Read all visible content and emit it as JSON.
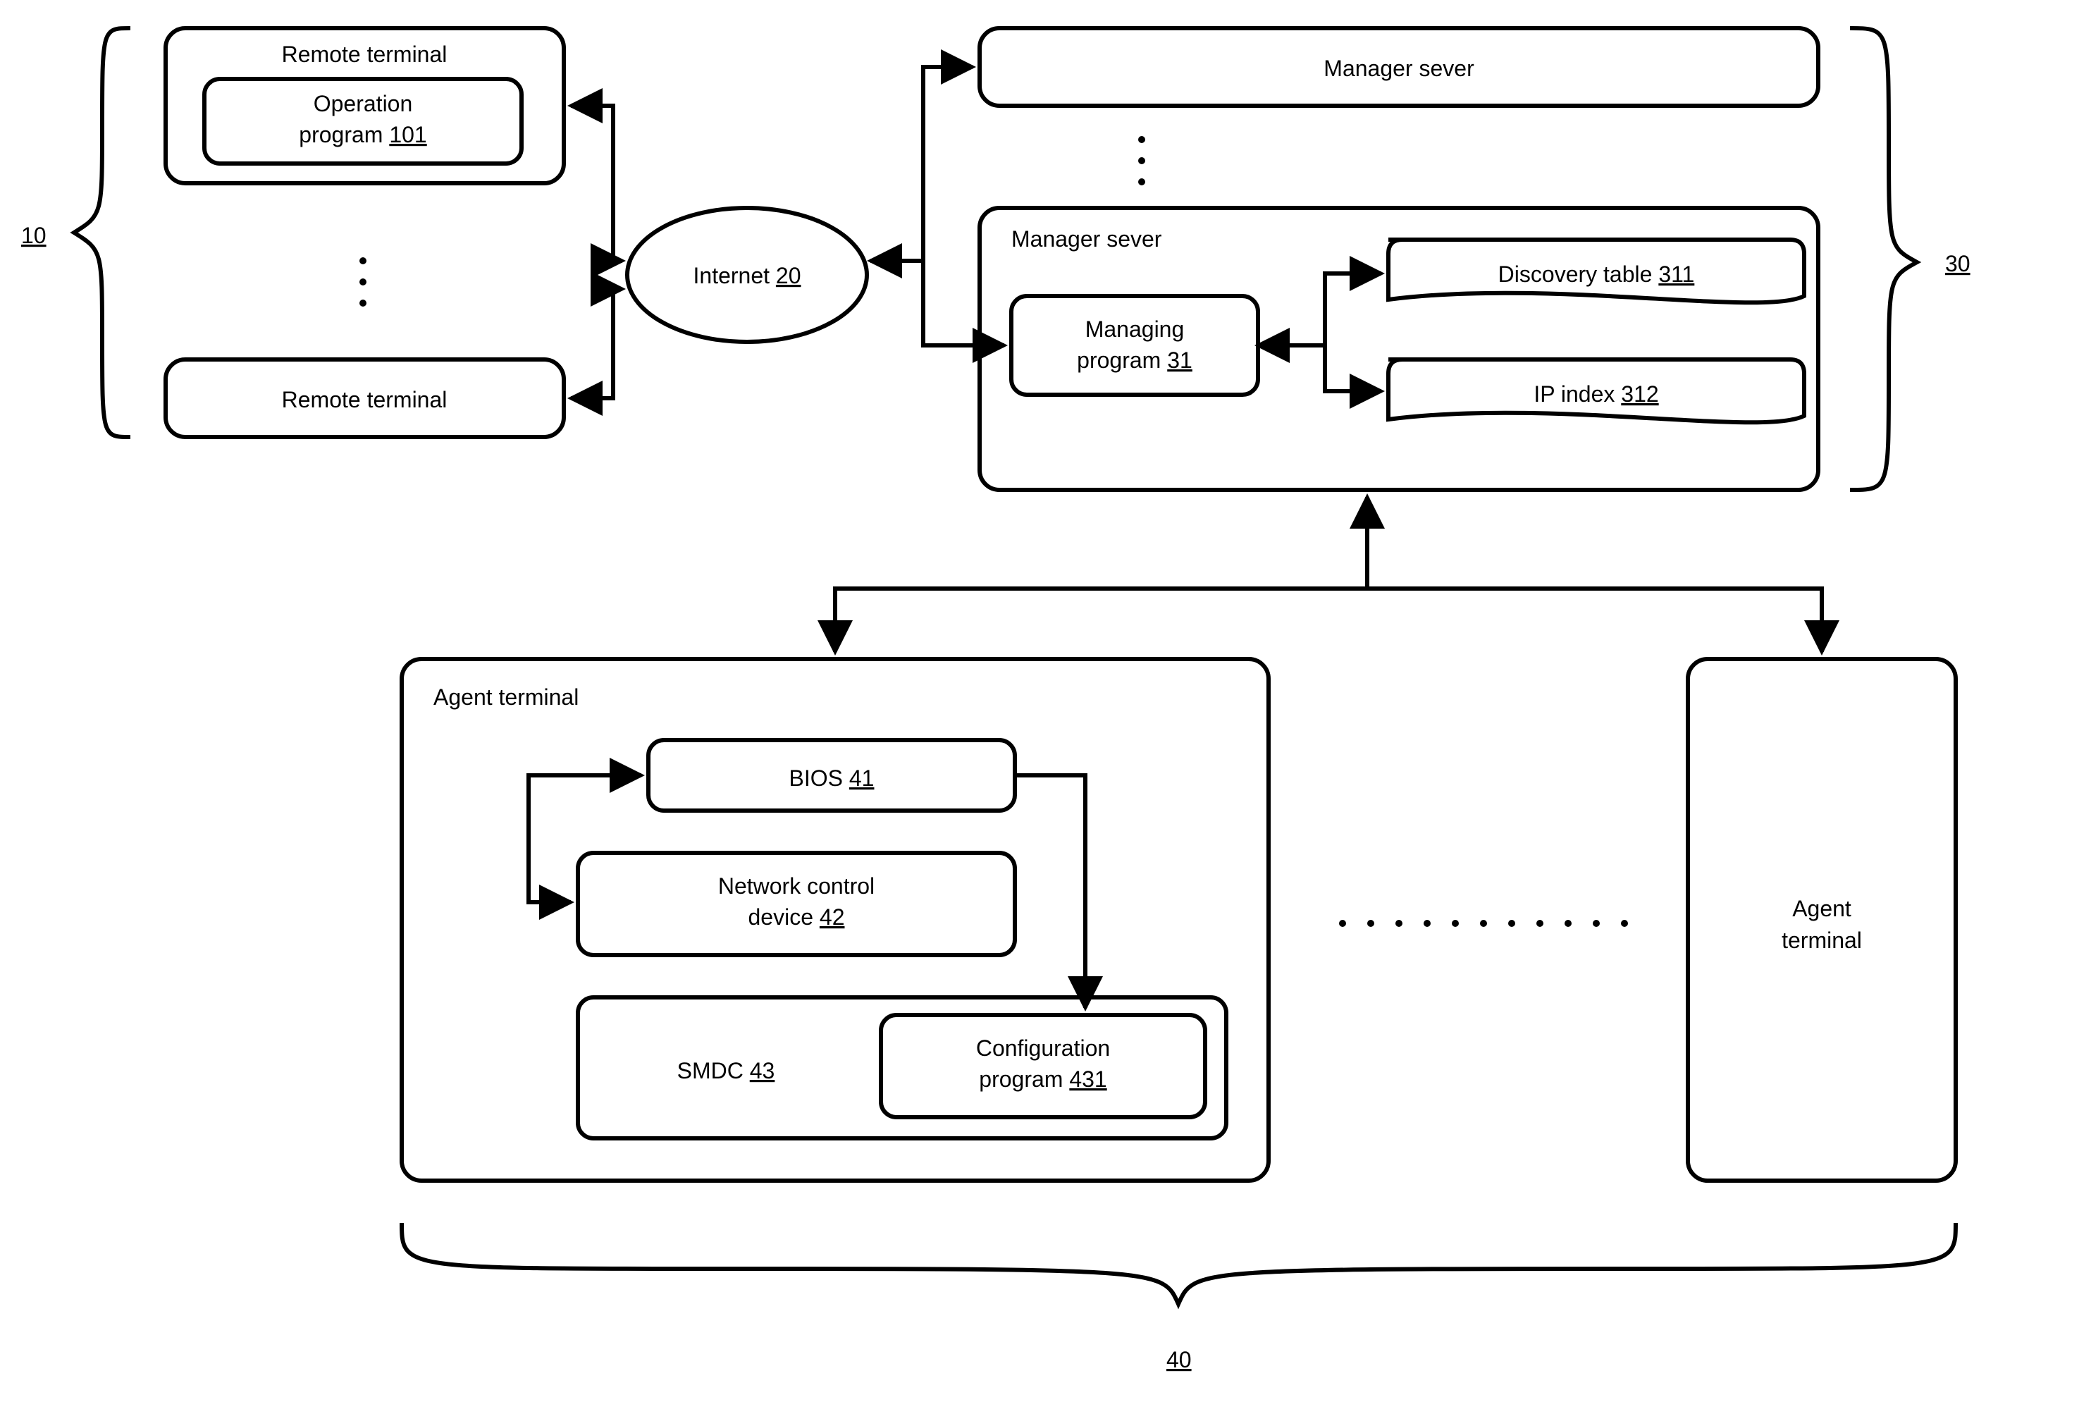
{
  "group10": {
    "label": "10"
  },
  "group30": {
    "label": "30"
  },
  "group40": {
    "label": "40"
  },
  "remoteTerminal1": {
    "title": "Remote terminal"
  },
  "opProgram": {
    "line1": "Operation",
    "line2_prefix": "program ",
    "line2_num": "101"
  },
  "remoteTerminal2": {
    "title": "Remote terminal"
  },
  "internet": {
    "label_prefix": "Internet ",
    "label_num": "20"
  },
  "managerServer1": {
    "title": "Manager sever"
  },
  "managerServer2": {
    "title": "Manager sever"
  },
  "managingProgram": {
    "line1": "Managing",
    "line2_prefix": "program ",
    "line2_num": "31"
  },
  "discoveryTable": {
    "label_prefix": "Discovery table ",
    "label_num": "311"
  },
  "ipIndex": {
    "label_prefix": "IP index ",
    "label_num": "312"
  },
  "agentTerminal1": {
    "title": "Agent terminal"
  },
  "agentTerminal2": {
    "line1": "Agent",
    "line2": "terminal"
  },
  "bios": {
    "label_prefix": "BIOS ",
    "label_num": "41"
  },
  "netCtrl": {
    "line1": "Network control",
    "line2_prefix": "device ",
    "line2_num": "42"
  },
  "smdc": {
    "label_prefix": "SMDC ",
    "label_num": "43"
  },
  "configProgram": {
    "line1": "Configuration",
    "line2_prefix": "program ",
    "line2_num": "431"
  }
}
